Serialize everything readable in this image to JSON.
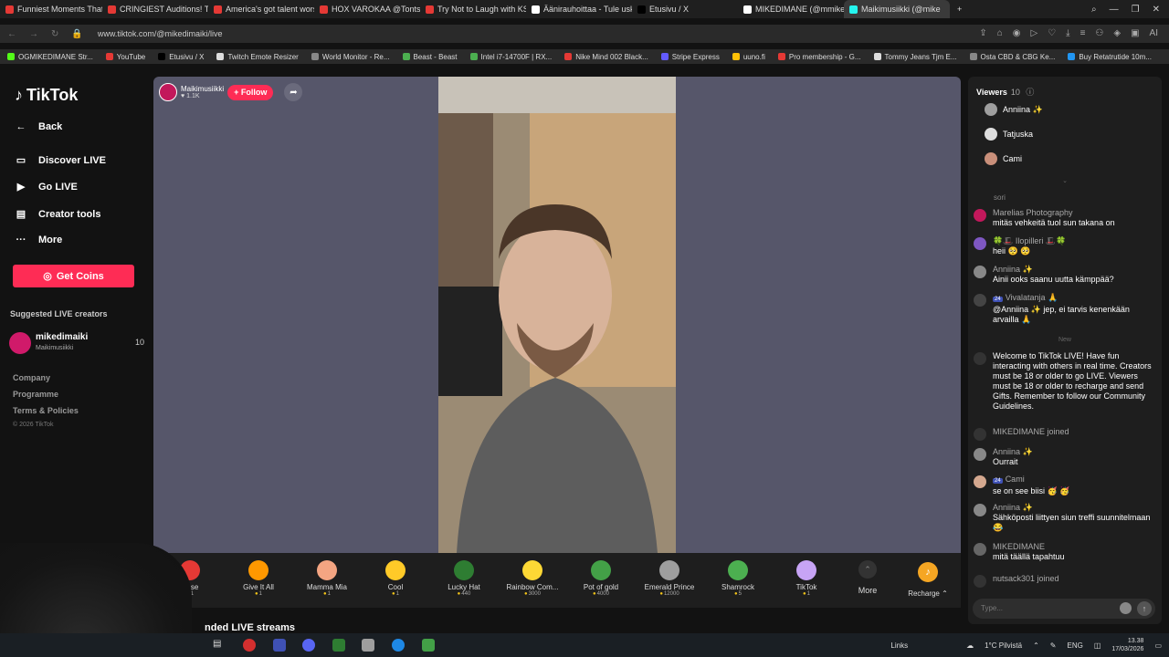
{
  "browser": {
    "tabs": [
      {
        "label": "Funniest Moments That M",
        "color": "#e53935"
      },
      {
        "label": "CRINGIEST Auditions! Try",
        "color": "#e53935"
      },
      {
        "label": "America's got talent worst",
        "color": "#e53935"
      },
      {
        "label": "HOX VAROKAA @Tontsa",
        "color": "#e53935"
      },
      {
        "label": "Try Not to Laugh with KSI",
        "color": "#e53935"
      },
      {
        "label": "Äänirauhoittaa - Tule uskon",
        "color": "#ffffff"
      },
      {
        "label": "Etusivu / X",
        "color": "#000000"
      },
      {
        "label": "MIKEDIMANE (@mmikedi",
        "color": "#ffffff"
      },
      {
        "label": "Maikimusiikki (@mike",
        "color": "#25f4ee",
        "active": true
      }
    ],
    "url": "www.tiktok.com/@mikedimaiki/live",
    "bookmarks": [
      {
        "label": "OGMIKEDIMANE Str...",
        "color": "#53fc18"
      },
      {
        "label": "YouTube",
        "color": "#e53935"
      },
      {
        "label": "Etusivu / X",
        "color": "#000000"
      },
      {
        "label": "Twitch Emote Resizer",
        "color": "#dddddd"
      },
      {
        "label": "World Monitor - Re...",
        "color": "#888888"
      },
      {
        "label": "Beast - Beast",
        "color": "#4caf50"
      },
      {
        "label": "Intel i7-14700F | RX...",
        "color": "#4caf50"
      },
      {
        "label": "Nike Mind 002 Black...",
        "color": "#e53935"
      },
      {
        "label": "Stripe Express",
        "color": "#635bff"
      },
      {
        "label": "uuno.fi",
        "color": "#ffc107"
      },
      {
        "label": "Pro membership - G...",
        "color": "#e53935"
      },
      {
        "label": "Tommy Jeans Tjm E...",
        "color": "#dddddd"
      },
      {
        "label": "Osta CBD & CBG Ke...",
        "color": "#888888"
      },
      {
        "label": "Buy Retatrutide 10m...",
        "color": "#2196f3"
      }
    ]
  },
  "sidebar": {
    "logo": "TikTok",
    "back": "Back",
    "discover": "Discover LIVE",
    "golive": "Go LIVE",
    "creator_tools": "Creator tools",
    "more": "More",
    "get_coins": "Get Coins",
    "suggested_title": "Suggested LIVE creators",
    "suggested": {
      "name": "mikedimaiki",
      "sub": "Maikimusiikki",
      "count": "10"
    },
    "footer": [
      "Company",
      "Programme",
      "Terms & Policies"
    ],
    "copyright": "© 2026 TikTok"
  },
  "stream": {
    "host_name": "Maikimusiikki",
    "host_likes": "1.1K",
    "follow_label": "+ Follow"
  },
  "gifts": [
    {
      "name": "Rose",
      "price": "1",
      "color": "#e53935"
    },
    {
      "name": "Give It All",
      "price": "1",
      "color": "#ff9800"
    },
    {
      "name": "Mamma Mia",
      "price": "1",
      "color": "#f4a582"
    },
    {
      "name": "Cool",
      "price": "1",
      "color": "#ffca28"
    },
    {
      "name": "Lucky Hat",
      "price": "440",
      "color": "#2e7d32"
    },
    {
      "name": "Rainbow Com...",
      "price": "3000",
      "color": "#fdd835"
    },
    {
      "name": "Pot of gold",
      "price": "4000",
      "color": "#43a047"
    },
    {
      "name": "Emerald Prince",
      "price": "12000",
      "color": "#9e9e9e"
    },
    {
      "name": "Shamrock",
      "price": "5",
      "color": "#4caf50"
    },
    {
      "name": "TikTok",
      "price": "1",
      "color": "#c7a4f5"
    }
  ],
  "gift_more": "More",
  "recharge": "Recharge",
  "recommended": "nded LIVE streams",
  "viewers": {
    "title": "Viewers",
    "count": "10",
    "top": [
      {
        "name": "Anniina ✨"
      },
      {
        "name": "Tatjuska"
      },
      {
        "name": "Cami"
      }
    ]
  },
  "chat": {
    "divider_top": "sori",
    "divider_new": "New",
    "messages": [
      {
        "user": "Marelias Photography",
        "text": "mitäs vehkeitä tuol sun takana on",
        "color": "#c2185b"
      },
      {
        "user": "🍀🎩 Ilopilleri 🎩🍀",
        "text": "heii 🥺 🥺",
        "color": "#7e57c2"
      },
      {
        "user": "Anniina ✨",
        "text": "Ainii ooks saanu uutta kämppää?",
        "color": "#888888"
      },
      {
        "user": "Vivalatanja 🙏",
        "text": "@Anniina ✨ jep, ei tarvis kenenkään arvailla 🙏",
        "color": "#444444",
        "badge": "24"
      },
      {
        "user": "",
        "text": "Welcome to TikTok LIVE! Have fun interacting with others in real time. Creators must be 18 or older to go LIVE. Viewers must be 18 or older to recharge and send Gifts. Remember to follow our Community Guidelines.",
        "color": "#333333"
      },
      {
        "user": "MIKEDIMANE  joined",
        "text": "",
        "color": "#333333"
      },
      {
        "user": "Anniina ✨",
        "text": "Ourrait",
        "color": "#888888"
      },
      {
        "user": "Cami",
        "text": "se on see biisi 🥳 🥳",
        "color": "#d4a88f",
        "badge": "24"
      },
      {
        "user": "Anniina ✨",
        "text": "Sähköposti liittyen siun treffi suunnitelmaan 😂",
        "color": "#888888"
      },
      {
        "user": "MIKEDIMANE",
        "text": "mitä täällä tapahtuu",
        "color": "#666666"
      },
      {
        "user": "nutsack301  joined",
        "text": "",
        "color": "#333333"
      }
    ],
    "placeholder": "Type..."
  },
  "taskbar": {
    "links": "Links",
    "weather": "1°C  Pilvistä",
    "lang": "ENG",
    "time": "13.38",
    "date": "17/03/2026"
  }
}
